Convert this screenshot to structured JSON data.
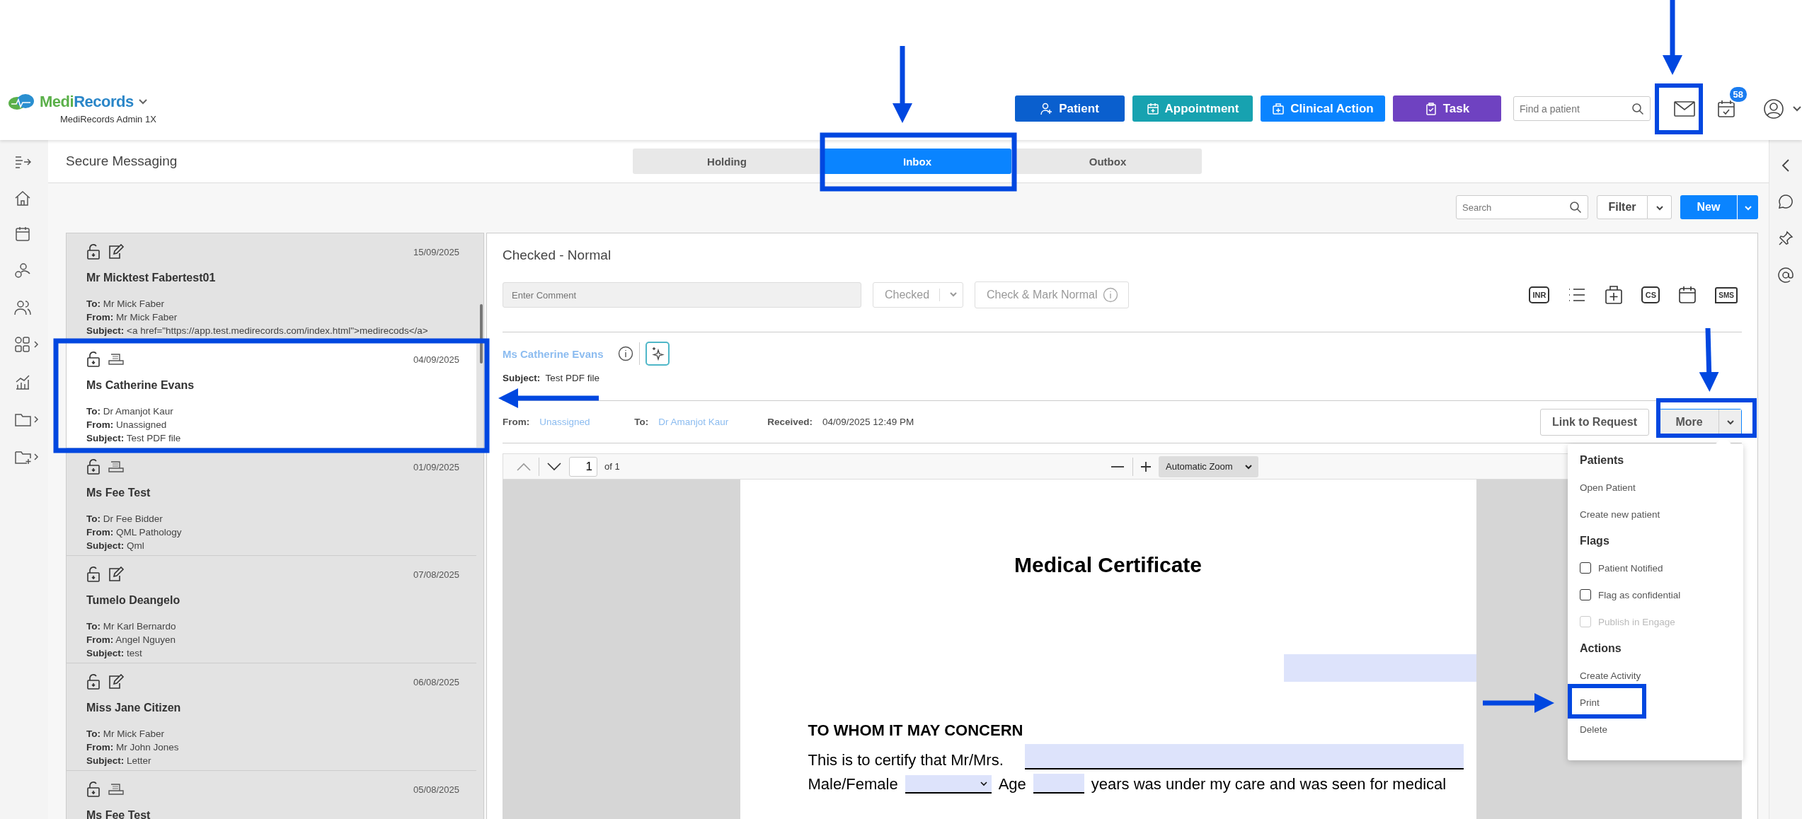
{
  "brand": {
    "part_1": "Medi",
    "part_2": "Records",
    "subtitle": "MediRecords Admin 1X"
  },
  "header_actions": [
    {
      "label": "Patient",
      "kind": "patient"
    },
    {
      "label": "Appointment",
      "kind": "appointment"
    },
    {
      "label": "Clinical Action",
      "kind": "clinical"
    },
    {
      "label": "Task",
      "kind": "task"
    }
  ],
  "patient_search": {
    "placeholder": "Find a patient"
  },
  "notifications": {
    "badge": "58"
  },
  "page_title": "Secure Messaging",
  "tabs": [
    {
      "label": "Holding",
      "selected": false
    },
    {
      "label": "Inbox",
      "selected": true
    },
    {
      "label": "Outbox",
      "selected": false
    }
  ],
  "toolbar": {
    "search_placeholder": "Search",
    "filter": "Filter",
    "new": "New"
  },
  "messages": [
    {
      "date": "15/09/2025",
      "name": "Mr Micktest Fabertest01",
      "kind": "note",
      "selected": false,
      "fields": [
        {
          "label": "To:",
          "value": "Mr Mick Faber"
        },
        {
          "label": "From:",
          "value": "Mr Mick Faber"
        },
        {
          "label": "Subject:",
          "value": "<a href=\"https://app.test.medirecords.com/index.html\">medirecods</a>"
        }
      ]
    },
    {
      "date": "04/09/2025",
      "name": "Ms Catherine Evans",
      "kind": "document",
      "selected": true,
      "fields": [
        {
          "label": "To:",
          "value": "Dr Amanjot Kaur"
        },
        {
          "label": "From:",
          "value": "Unassigned"
        },
        {
          "label": "Subject:",
          "value": "Test PDF file"
        }
      ]
    },
    {
      "date": "01/09/2025",
      "name": "Ms Fee Test",
      "kind": "document",
      "selected": false,
      "fields": [
        {
          "label": "To:",
          "value": "Dr Fee Bidder"
        },
        {
          "label": "From:",
          "value": "QML Pathology"
        },
        {
          "label": "Subject:",
          "value": "Qml"
        }
      ]
    },
    {
      "date": "07/08/2025",
      "name": "Tumelo Deangelo",
      "kind": "note",
      "selected": false,
      "fields": [
        {
          "label": "To:",
          "value": "Mr Karl Bernardo"
        },
        {
          "label": "From:",
          "value": "Angel Nguyen"
        },
        {
          "label": "Subject:",
          "value": "test"
        }
      ]
    },
    {
      "date": "06/08/2025",
      "name": "Miss Jane Citizen",
      "kind": "note",
      "selected": false,
      "fields": [
        {
          "label": "To:",
          "value": "Mr Mick Faber"
        },
        {
          "label": "From:",
          "value": "Mr John Jones"
        },
        {
          "label": "Subject:",
          "value": "Letter"
        }
      ]
    },
    {
      "date": "05/08/2025",
      "name": "Ms Fee Test",
      "kind": "document",
      "selected": false
    }
  ],
  "detail": {
    "status_title": "Checked - Normal",
    "comment_placeholder": "Enter Comment",
    "status_select": "Checked",
    "check_button": "Check & Mark Normal",
    "tool_icons": [
      {
        "kind": "inr",
        "label": "INR"
      },
      {
        "kind": "list"
      },
      {
        "kind": "medkit"
      },
      {
        "kind": "cs",
        "label": "CS"
      },
      {
        "kind": "calendar"
      },
      {
        "kind": "sms",
        "label": "SMS"
      }
    ],
    "patient_link": "Ms Catherine Evans",
    "subject_label": "Subject:",
    "subject": "Test PDF file",
    "from_label": "From:",
    "from": "Unassigned",
    "to_label": "To:",
    "to": "Dr Amanjot Kaur",
    "received_label": "Received:",
    "received": "04/09/2025 12:49 PM",
    "link_button": "Link to Request",
    "more_button": "More"
  },
  "pdf": {
    "page": "1",
    "page_count": "of 1",
    "zoom": "Automatic Zoom",
    "document": {
      "title": "Medical Certificate",
      "heading": "TO WHOM IT MAY CONCERN",
      "line_1": "This is to certify that Mr/Mrs.",
      "gender_label": "Male/Female",
      "age_label": "Age",
      "line_2_end": "years was under my care and was seen for medical"
    }
  },
  "menu": {
    "sections": [
      {
        "title": "Patients",
        "items": [
          {
            "kind": "link",
            "label": "Open Patient"
          },
          {
            "kind": "link",
            "label": "Create new patient"
          }
        ]
      },
      {
        "title": "Flags",
        "items": [
          {
            "kind": "checkbox",
            "label": "Patient Notified",
            "checked": false,
            "disabled": false
          },
          {
            "kind": "checkbox",
            "label": "Flag as confidential",
            "checked": false,
            "disabled": false
          },
          {
            "kind": "checkbox",
            "label": "Publish in Engage",
            "checked": false,
            "disabled": true
          }
        ]
      },
      {
        "title": "Actions",
        "items": [
          {
            "kind": "link",
            "label": "Create Activity"
          },
          {
            "kind": "link",
            "label": "Print"
          },
          {
            "kind": "link",
            "label": "Delete"
          }
        ]
      }
    ]
  }
}
